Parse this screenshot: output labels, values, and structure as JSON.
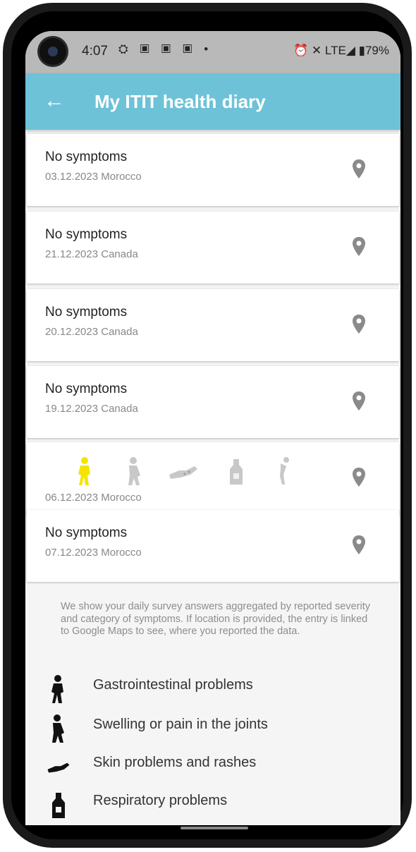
{
  "status_bar": {
    "time": "4:07",
    "left_icons": "⛭ ▣ ▣ ▣ •",
    "right": "⏰ ✕ LTE◢ ▮79%"
  },
  "app_bar": {
    "back_icon": "←",
    "title": "My ITIT health diary"
  },
  "entries": [
    {
      "title": "No symptoms",
      "subtitle": "03.12.2023 Morocco"
    },
    {
      "title": "No symptoms",
      "subtitle": "21.12.2023 Canada"
    },
    {
      "title": "No symptoms",
      "subtitle": "20.12.2023 Canada"
    },
    {
      "title": "No symptoms",
      "subtitle": "19.12.2023 Canada"
    },
    {
      "title": "",
      "subtitle": "06.12.2023 Morocco",
      "symptom_icons": [
        "gastrointestinal-icon",
        "joint-pain-icon",
        "skin-rash-icon",
        "respiratory-icon",
        "other-symptom-icon"
      ],
      "active_color": "#f5e400"
    },
    {
      "title": "No symptoms",
      "subtitle": "07.12.2023 Morocco"
    }
  ],
  "info_text": "We show your daily survey answers aggregated by reported severity and category of symptoms. If location is provided, the entry is linked to Google Maps to see, where you reported the data.",
  "legend": [
    {
      "label": "Gastrointestinal problems",
      "icon": "gastrointestinal-icon"
    },
    {
      "label": "Swelling or pain in the joints",
      "icon": "joint-pain-icon"
    },
    {
      "label": "Skin problems and rashes",
      "icon": "skin-rash-icon"
    },
    {
      "label": "Respiratory problems",
      "icon": "respiratory-icon"
    }
  ],
  "colors": {
    "app_bar": "#6ec2d7",
    "pin": "#8a8a8a",
    "inactive_icon": "#c8c8c8",
    "active_icon": "#f5e400"
  }
}
